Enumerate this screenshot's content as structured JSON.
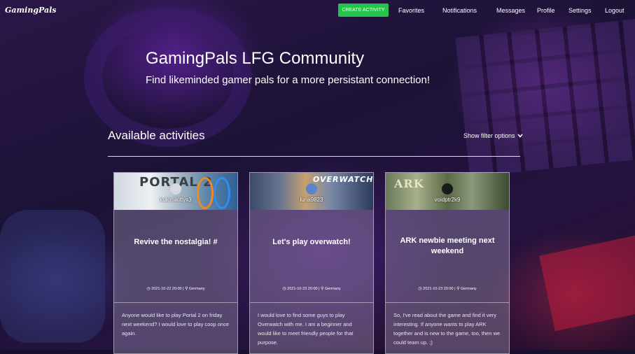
{
  "brand": "GamingPals",
  "nav": {
    "create_label": "CREATE ACTIVITY",
    "links": [
      "Favorites",
      "Notifications",
      "Messages",
      "Profile",
      "Settings",
      "Logout"
    ]
  },
  "hero": {
    "title": "GamingPals LFG Community",
    "subtitle": "Find likeminded gamer pals for a more persistant connection!"
  },
  "activities": {
    "heading": "Available activities",
    "filter_label": "Show filter options",
    "cards": [
      {
        "game": "PORTAL 2",
        "username": "kukimikittyx3",
        "title": "Revive the nostalgia! #",
        "datetime": "2021-10-22 20:00",
        "location": "Germany",
        "description": "Anyone would like to play Portal 2 on friday next weekend? I would love to play coop once again."
      },
      {
        "game": "OVERWATCH",
        "username": "luna9823",
        "title": "Let's play overwatch!",
        "datetime": "2021-10-23 20:00",
        "location": "Germany",
        "description": "I would love to find some guys to play Overwatch with me. I am a beginner and would like to meet friendly people for that purpose."
      },
      {
        "game": "ARK",
        "username": "voidptr2k9",
        "title": "ARK newbie meeting next weekend",
        "datetime": "2021-10-23 20:00",
        "location": "Germany",
        "description": "So, I've read about the game and find it very interesting. If anyone wants to play ARK together and is new to the game, too, then we could team up. ;)"
      }
    ]
  },
  "colors": {
    "create_button": "#27c24c",
    "card_background": "rgba(190,180,210,0.32)"
  }
}
